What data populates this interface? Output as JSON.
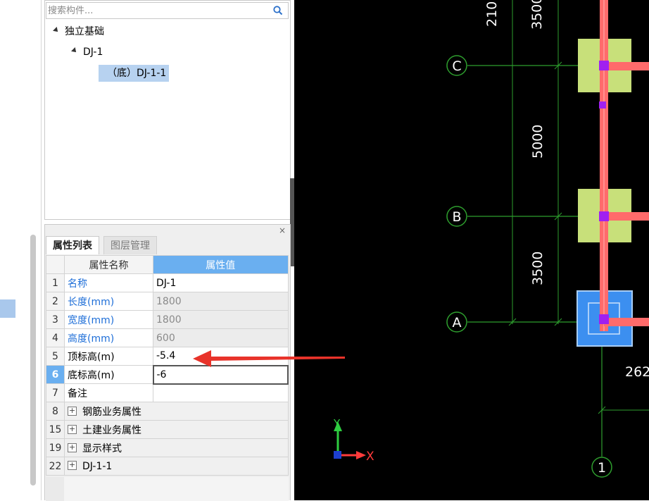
{
  "search": {
    "placeholder": "搜索构件..."
  },
  "tree": {
    "root": "独立基础",
    "child": "DJ-1",
    "leaf": "（底）DJ-1-1"
  },
  "properties_panel": {
    "close": "×",
    "tabs": [
      "属性列表",
      "图层管理"
    ],
    "headers": {
      "name": "属性名称",
      "value": "属性值"
    },
    "rows": [
      {
        "num": "1",
        "name": "名称",
        "value": "DJ-1"
      },
      {
        "num": "2",
        "name": "长度(mm)",
        "value": "1800"
      },
      {
        "num": "3",
        "name": "宽度(mm)",
        "value": "1800"
      },
      {
        "num": "4",
        "name": "高度(mm)",
        "value": "600"
      },
      {
        "num": "5",
        "name": "顶标高(m)",
        "value": "-5.4"
      },
      {
        "num": "6",
        "name": "底标高(m)",
        "value": "-6"
      },
      {
        "num": "7",
        "name": "备注",
        "value": ""
      },
      {
        "num": "8",
        "name": "钢筋业务属性",
        "value": ""
      },
      {
        "num": "15",
        "name": "土建业务属性",
        "value": ""
      },
      {
        "num": "19",
        "name": "显示样式",
        "value": ""
      },
      {
        "num": "22",
        "name": "DJ-1-1",
        "value": ""
      }
    ]
  },
  "canvas": {
    "axis_labels": {
      "c": "C",
      "b": "B",
      "a": "A",
      "one": "1"
    },
    "dimensions": {
      "d210": "210",
      "d3500_top": "3500",
      "d5000": "5000",
      "d3500": "3500",
      "d262": "262"
    },
    "ucs": {
      "y": "Y",
      "x": "X"
    }
  },
  "colors": {
    "grid_line": "#2e9e2e",
    "beam": "#ff6b6b",
    "footing": "#c8e07a",
    "selected_footing": "#3c8ff0",
    "node": "#a020f0",
    "arrow": "#e8332a",
    "accent_blue": "#6aaff0"
  }
}
